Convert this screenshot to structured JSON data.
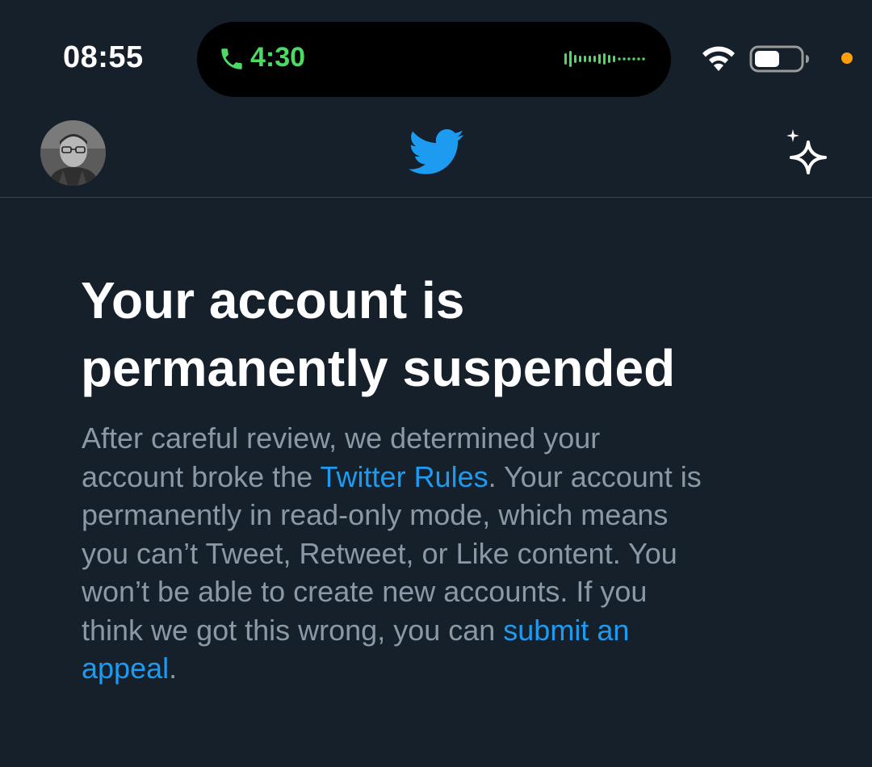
{
  "status_bar": {
    "time": "08:55",
    "call_timer": "4:30",
    "call_color": "#4cd964",
    "icons": [
      "phone-icon",
      "waveform-icon",
      "wifi-icon",
      "battery-icon",
      "privacy-indicator-dot"
    ]
  },
  "header": {
    "icons": [
      "avatar",
      "twitter-bird-icon",
      "sparkle-icon"
    ],
    "brand_color": "#1d9bf0"
  },
  "main": {
    "title_line1": "Your account is",
    "title_line2": "permanently suspended",
    "body": {
      "line1": "After careful review, we determined your",
      "line2_before": "account broke the ",
      "rules_link": "Twitter Rules",
      "line2_after": ". Your account is",
      "line3": "permanently in read-only mode, which means",
      "line4": "you can’t Tweet, Retweet, or Like content. You",
      "line5": "won’t be able to create new accounts. If you",
      "line6_before": "think we got this wrong, you can ",
      "appeal_link_part1": "submit an",
      "appeal_link_part2": "appeal",
      "line7_after": "."
    }
  },
  "colors": {
    "background": "#15202b",
    "text_primary": "#ffffff",
    "text_secondary": "#8b98a5",
    "link": "#1d9bf0"
  }
}
